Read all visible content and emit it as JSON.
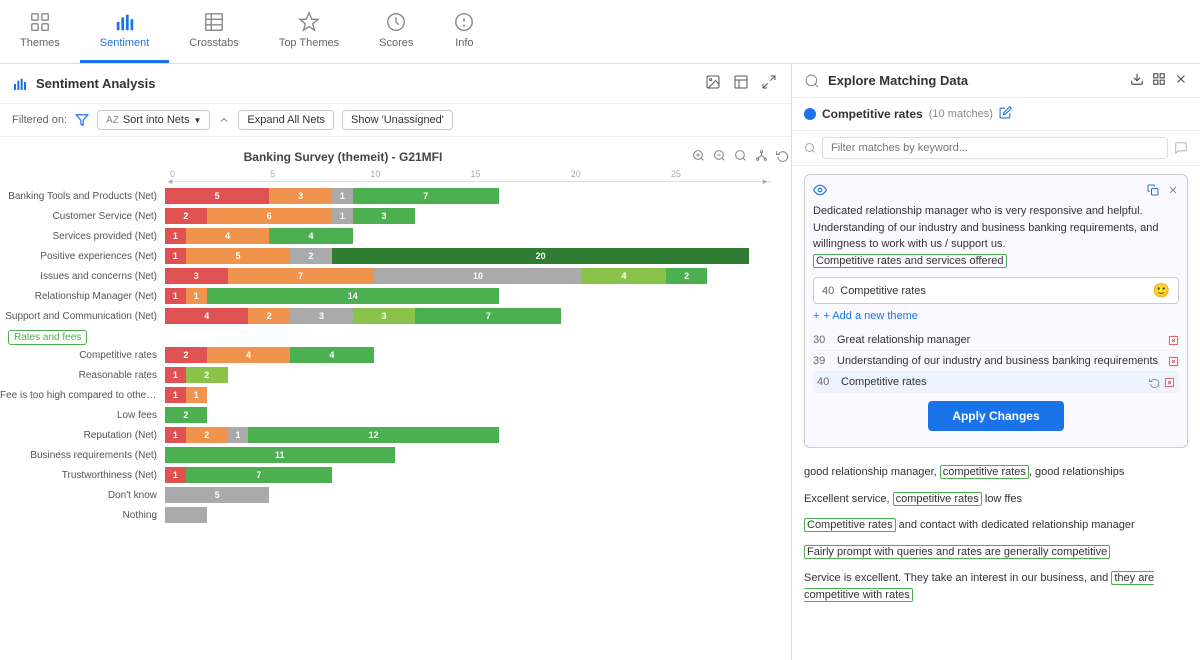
{
  "nav": {
    "items": [
      {
        "id": "themes",
        "label": "Themes",
        "icon": "grid"
      },
      {
        "id": "sentiment",
        "label": "Sentiment",
        "icon": "bar-chart",
        "active": true
      },
      {
        "id": "crosstabs",
        "label": "Crosstabs",
        "icon": "table"
      },
      {
        "id": "top-themes",
        "label": "Top Themes",
        "icon": "top"
      },
      {
        "id": "scores",
        "label": "Scores",
        "icon": "scores"
      },
      {
        "id": "info",
        "label": "Info",
        "icon": "info"
      }
    ]
  },
  "left_panel": {
    "title": "Sentiment Analysis",
    "filtered_on": "Filtered on:",
    "sort_label": "Sort into Nets",
    "expand_label": "Expand All Nets",
    "show_unassigned": "Show 'Unassigned'",
    "chart_title": "Banking Survey (themeit) - G21MFI",
    "scale": [
      "0",
      "5",
      "10",
      "15",
      "20",
      "25"
    ],
    "rows": [
      {
        "label": "Banking Tools and Products (Net)",
        "segs": [
          {
            "w": 5,
            "cls": "bar-seg-red",
            "v": "5"
          },
          {
            "w": 3,
            "cls": "bar-seg-orange",
            "v": "3"
          },
          {
            "w": 1,
            "cls": "bar-seg-gray",
            "v": "1"
          },
          {
            "w": 7,
            "cls": "bar-seg-green",
            "v": "7"
          }
        ]
      },
      {
        "label": "Customer Service (Net)",
        "segs": [
          {
            "w": 2,
            "cls": "bar-seg-red",
            "v": "2"
          },
          {
            "w": 6,
            "cls": "bar-seg-orange",
            "v": "6"
          },
          {
            "w": 1,
            "cls": "bar-seg-gray",
            "v": "1"
          },
          {
            "w": 3,
            "cls": "bar-seg-green",
            "v": "3"
          }
        ]
      },
      {
        "label": "Services provided (Net)",
        "segs": [
          {
            "w": 1,
            "cls": "bar-seg-red",
            "v": "1"
          },
          {
            "w": 4,
            "cls": "bar-seg-orange",
            "v": "4"
          },
          {
            "w": 4,
            "cls": "bar-seg-green",
            "v": "4"
          }
        ]
      },
      {
        "label": "Positive experiences (Net)",
        "segs": [
          {
            "w": 1,
            "cls": "bar-seg-red",
            "v": "1"
          },
          {
            "w": 5,
            "cls": "bar-seg-orange",
            "v": "5"
          },
          {
            "w": 2,
            "cls": "bar-seg-gray",
            "v": "2"
          },
          {
            "w": 20,
            "cls": "bar-seg-dkgreen",
            "v": "20"
          }
        ]
      },
      {
        "label": "Issues and concerns (Net)",
        "segs": [
          {
            "w": 3,
            "cls": "bar-seg-red",
            "v": "3"
          },
          {
            "w": 7,
            "cls": "bar-seg-orange",
            "v": "7"
          },
          {
            "w": 10,
            "cls": "bar-seg-gray",
            "v": "10"
          },
          {
            "w": 4,
            "cls": "bar-seg-ltgreen",
            "v": "4"
          },
          {
            "w": 2,
            "cls": "bar-seg-green",
            "v": "2"
          }
        ]
      },
      {
        "label": "Relationship Manager (Net)",
        "segs": [
          {
            "w": 1,
            "cls": "bar-seg-red",
            "v": "1"
          },
          {
            "w": 1,
            "cls": "bar-seg-orange",
            "v": "1"
          },
          {
            "w": 14,
            "cls": "bar-seg-green",
            "v": "14"
          }
        ]
      },
      {
        "label": "Support and Communication (Net)",
        "segs": [
          {
            "w": 4,
            "cls": "bar-seg-red",
            "v": "4"
          },
          {
            "w": 2,
            "cls": "bar-seg-orange",
            "v": "2"
          },
          {
            "w": 3,
            "cls": "bar-seg-gray",
            "v": "3"
          },
          {
            "w": 3,
            "cls": "bar-seg-ltgreen",
            "v": "3"
          },
          {
            "w": 7,
            "cls": "bar-seg-green",
            "v": "7"
          }
        ]
      },
      {
        "label": "Competitive rates",
        "segs": [
          {
            "w": 2,
            "cls": "bar-seg-red",
            "v": "2"
          },
          {
            "w": 4,
            "cls": "bar-seg-orange",
            "v": "4"
          },
          {
            "w": 4,
            "cls": "bar-seg-green",
            "v": "4"
          }
        ],
        "section": "Rates and fees"
      },
      {
        "label": "Reasonable rates",
        "segs": [
          {
            "w": 1,
            "cls": "bar-seg-red",
            "v": "1"
          },
          {
            "w": 2,
            "cls": "bar-seg-ltgreen",
            "v": "2"
          }
        ]
      },
      {
        "label": "Fee is too high compared to other b...",
        "segs": [
          {
            "w": 1,
            "cls": "bar-seg-red",
            "v": "1"
          },
          {
            "w": 1,
            "cls": "bar-seg-orange",
            "v": "1"
          }
        ]
      },
      {
        "label": "Low fees",
        "segs": [
          {
            "w": 2,
            "cls": "bar-seg-green",
            "v": "2"
          }
        ]
      },
      {
        "label": "Reputation (Net)",
        "segs": [
          {
            "w": 1,
            "cls": "bar-seg-red",
            "v": "1"
          },
          {
            "w": 2,
            "cls": "bar-seg-orange",
            "v": "2"
          },
          {
            "w": 1,
            "cls": "bar-seg-gray",
            "v": "1"
          },
          {
            "w": 12,
            "cls": "bar-seg-green",
            "v": "12"
          }
        ]
      },
      {
        "label": "Business requirements (Net)",
        "segs": [
          {
            "w": 11,
            "cls": "bar-seg-green",
            "v": "11"
          }
        ]
      },
      {
        "label": "Trustworthiness (Net)",
        "segs": [
          {
            "w": 1,
            "cls": "bar-seg-red",
            "v": "1"
          },
          {
            "w": 7,
            "cls": "bar-seg-green",
            "v": "7"
          }
        ]
      },
      {
        "label": "Don't know",
        "segs": [
          {
            "w": 5,
            "cls": "bar-seg-gray",
            "v": "5"
          }
        ]
      },
      {
        "label": "Nothing",
        "segs": [
          {
            "w": 2,
            "cls": "bar-seg-gray",
            "v": ""
          }
        ]
      }
    ]
  },
  "right_panel": {
    "title": "Explore Matching Data",
    "match_label": "Competitive rates",
    "match_count": "(10 matches)",
    "filter_placeholder": "Filter matches by keyword...",
    "edit_box": {
      "quote": "Dedicated relationship manager who is very responsive and helpful. Understanding of our industry and business banking requirements, and willingness to work with us / support us.",
      "highlight": "Competitive rates and services offered",
      "theme_num": "40",
      "theme_name": "Competitive rates",
      "add_theme": "+ Add a new theme",
      "themes": [
        {
          "num": "30",
          "name": "Great relationship manager"
        },
        {
          "num": "39",
          "name": "Understanding of our industry and business banking requirements"
        },
        {
          "num": "40",
          "name": "Competitive rates",
          "active": true
        }
      ],
      "apply_label": "Apply Changes"
    },
    "matches": [
      {
        "text": "good relationship manager, ",
        "highlight": "competitive rates",
        "text2": ", good relationships"
      },
      {
        "text": "Excellent service, ",
        "highlight": "competitive rates",
        "text2": " low ffes"
      },
      {
        "text": "",
        "highlight": "Competitive rates",
        "text2": " and contact with dedicated relationship manager"
      },
      {
        "text": "Fairly prompt with queries and rates are generally competitive",
        "highlight_full": true
      },
      {
        "text": "Service is excellent. They take an interest in our business, and ",
        "highlight2": "they are competitive with rates"
      }
    ]
  }
}
